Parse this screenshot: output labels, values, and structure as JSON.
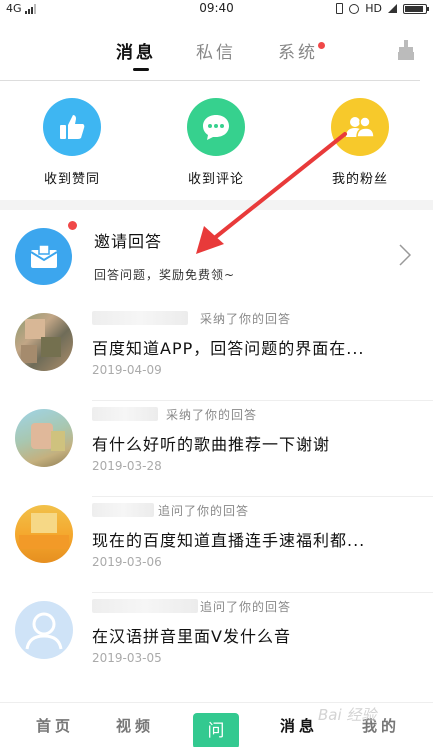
{
  "status_bar": {
    "network": "4G",
    "time": "09:40",
    "hd_label": "HD"
  },
  "header": {
    "tabs": [
      {
        "label": "消息",
        "active": true
      },
      {
        "label": "私信",
        "active": false
      },
      {
        "label": "系统",
        "active": false,
        "has_dot": true
      }
    ]
  },
  "actions": [
    {
      "label": "收到赞同",
      "icon": "thumbs-up-icon",
      "color": "#3eb6f2"
    },
    {
      "label": "收到评论",
      "icon": "comment-icon",
      "color": "#36d18e"
    },
    {
      "label": "我的粉丝",
      "icon": "fans-icon",
      "color": "#f7c92b"
    }
  ],
  "invite": {
    "title": "邀请回答",
    "subtitle": "回答问题，奖励免费领~",
    "icon": "mail-icon",
    "color": "#3ca6ee"
  },
  "messages": [
    {
      "action": "采纳了你的回答",
      "question": "百度知道APP，回答问题的界面在...",
      "date": "2019-04-09"
    },
    {
      "action": "采纳了你的回答",
      "question": "有什么好听的歌曲推荐一下谢谢",
      "date": "2019-03-28"
    },
    {
      "action": "追问了你的回答",
      "question": "现在的百度知道直播连手速福利都...",
      "date": "2019-03-06"
    },
    {
      "action": "追问了你的回答",
      "question": "在汉语拼音里面V发什么音",
      "date": "2019-03-05"
    }
  ],
  "bottom_nav": {
    "home": "首页",
    "video": "视频",
    "ask": "问",
    "messages": "消息",
    "mine": "我的"
  },
  "watermark": "Bai 经验",
  "colors": {
    "accent_green": "#33c990",
    "red_dot": "#f04848",
    "arrow": "#e83a3a"
  }
}
